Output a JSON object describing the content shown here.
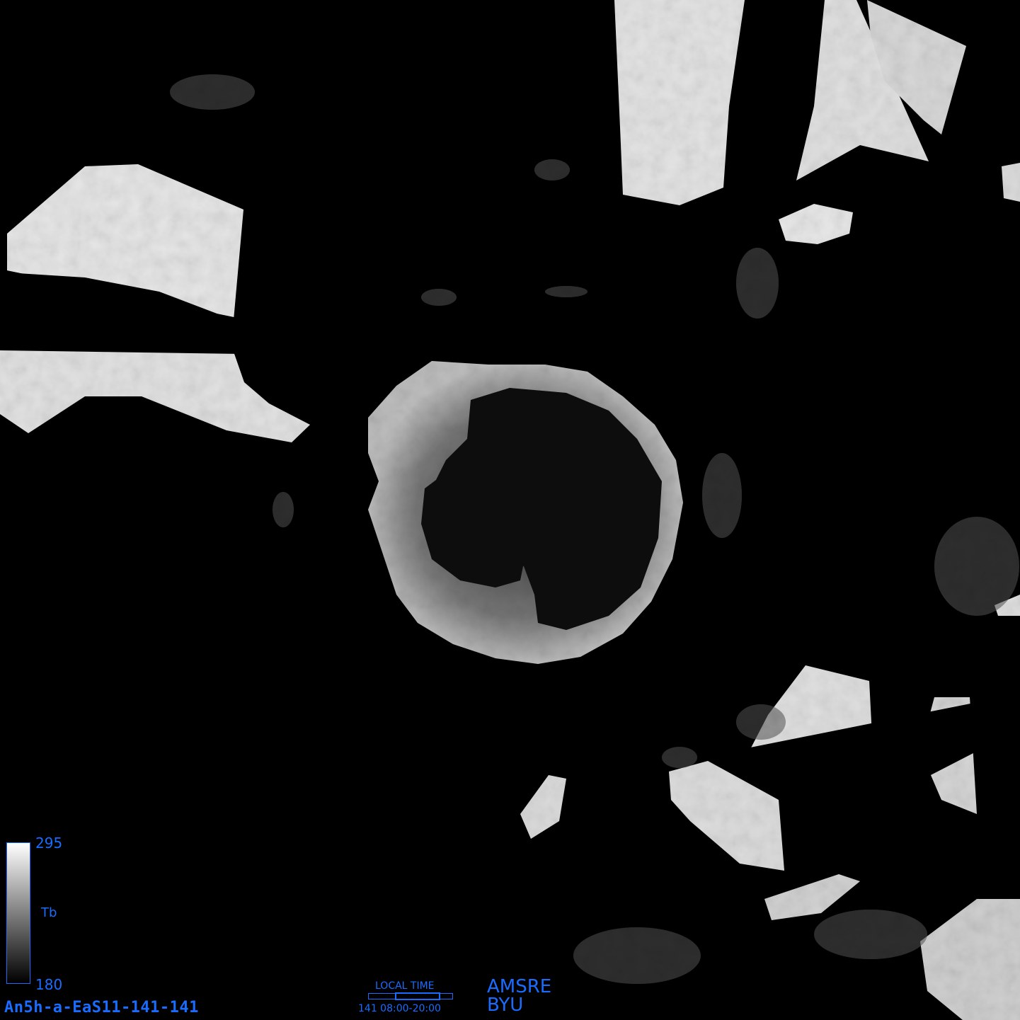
{
  "image": {
    "description_icon": "polar-brightness-temperature-map",
    "colormap": {
      "top_color": "#ffffff",
      "bottom_color": "#000000",
      "label_color": "#1a6cff"
    }
  },
  "colorbar": {
    "max": "295",
    "min": "180",
    "variable": "Tb"
  },
  "file_id": "An5h-a-EaS11-141-141",
  "local_time": {
    "title": "LOCAL TIME",
    "range_text": "141  08:00-20:00"
  },
  "sensor": "AMSRE",
  "organization": "BYU"
}
